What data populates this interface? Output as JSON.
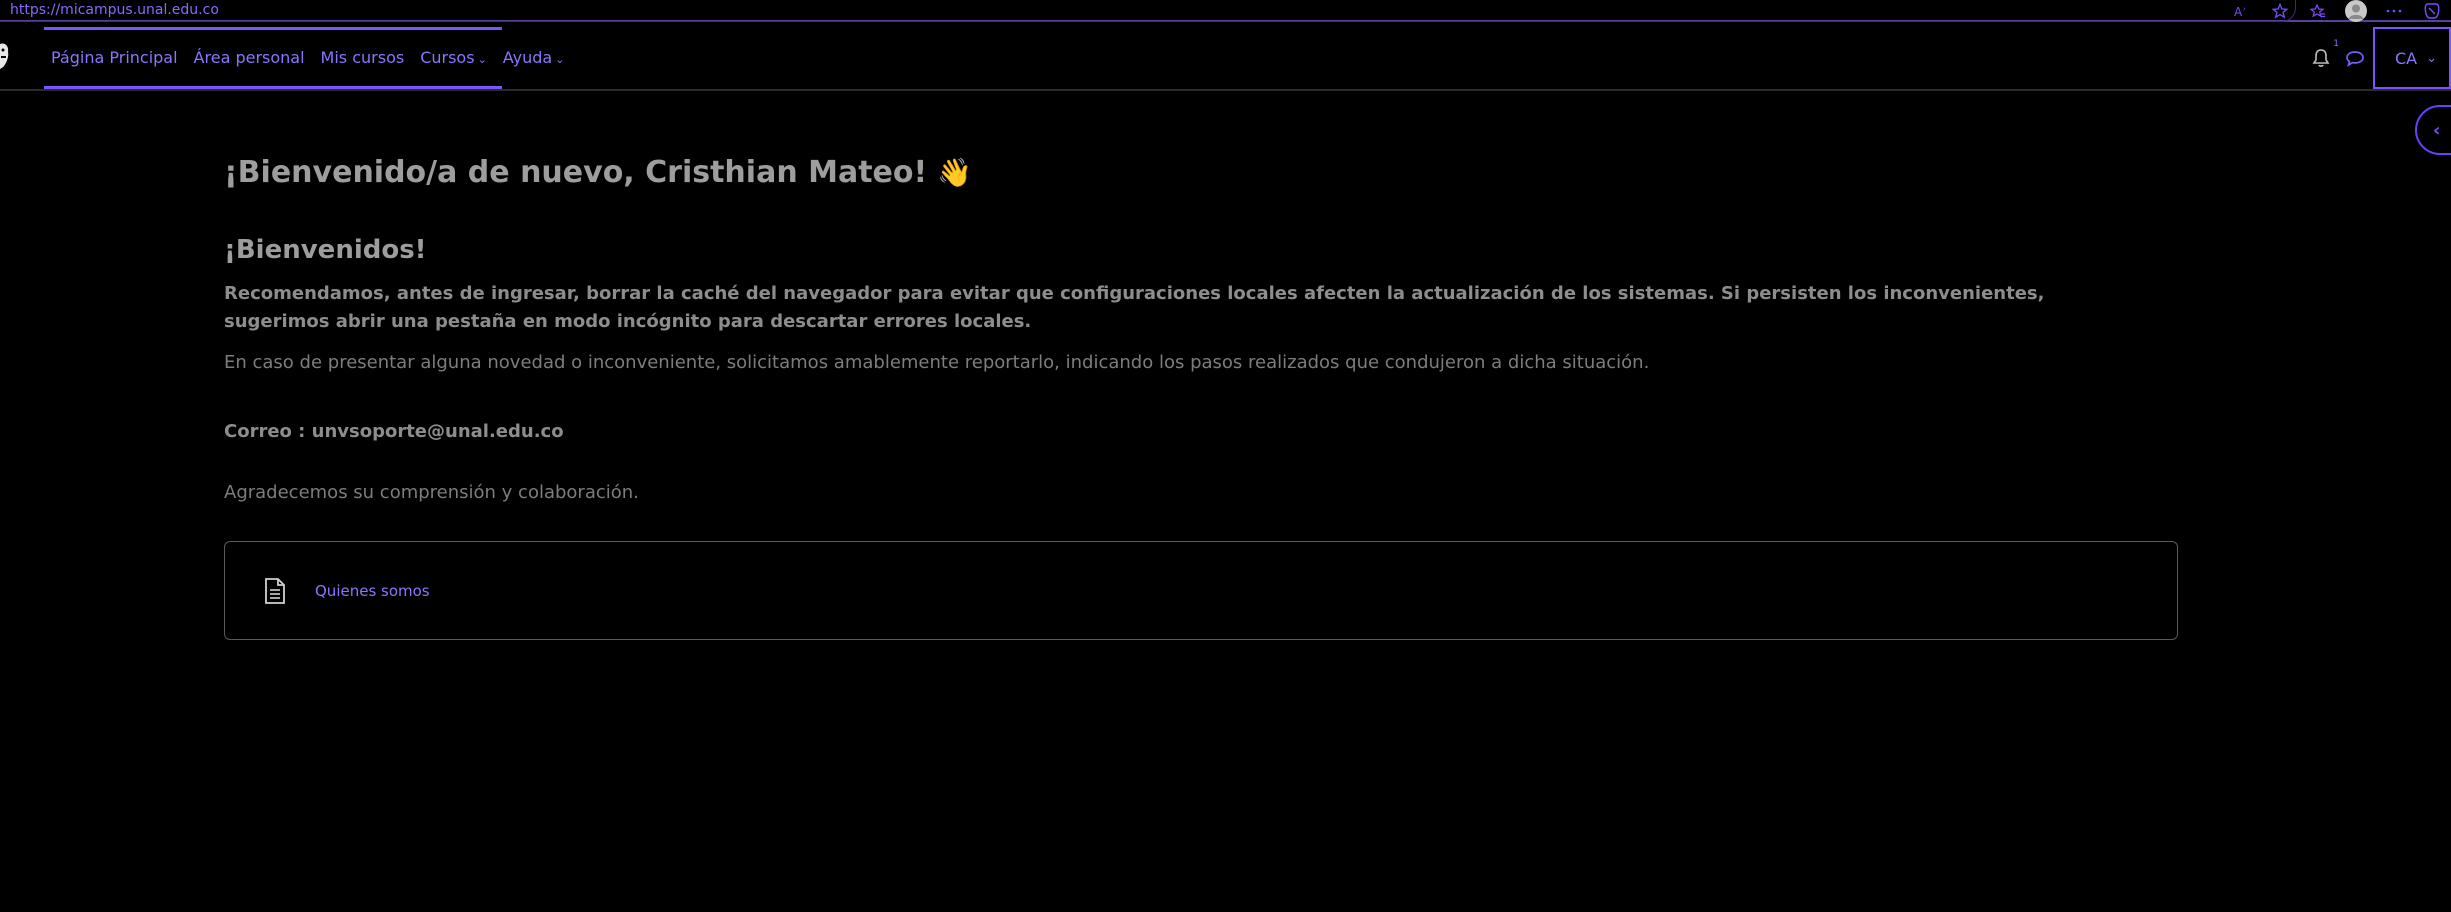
{
  "browser": {
    "url": "https://micampus.unal.edu.co",
    "icons": [
      "read-aloud-icon",
      "favorite-star-icon",
      "favorites-icon",
      "profile-avatar-icon",
      "more-icon",
      "copilot-icon"
    ]
  },
  "navbar": {
    "links": [
      {
        "label": "Página Principal"
      },
      {
        "label": "Área personal"
      },
      {
        "label": "Mis cursos"
      },
      {
        "label": "Cursos",
        "dropdown": true
      },
      {
        "label": "Ayuda",
        "dropdown": true
      }
    ],
    "notifications_count": "1",
    "user_initials": "CA"
  },
  "main": {
    "welcome": "¡Bienvenido/a de nuevo, Cristhian Mateo!",
    "wave_emoji": "👋",
    "section_title": "¡Bienvenidos!",
    "recommend_text": "Recomendamos, antes de ingresar, borrar la caché del navegador para evitar que configuraciones locales afecten la actualización de los sistemas. Si persisten los inconvenientes, sugerimos abrir una pestaña en modo incógnito para descartar errores locales.",
    "novedad_text": "En caso de presentar alguna novedad o inconveniente, solicitamos amablemente reportarlo, indicando los pasos realizados que condujeron a dicha situación.",
    "correo_text": "Correo : unvsoporte@unal.edu.co",
    "agradecemos_text": "Agradecemos su comprensión y colaboración.",
    "card": {
      "icon": "document-icon",
      "link_label": "Quienes somos"
    }
  },
  "colors": {
    "accent": "#7a55ff",
    "link": "#8b74ff",
    "background": "#000000"
  }
}
